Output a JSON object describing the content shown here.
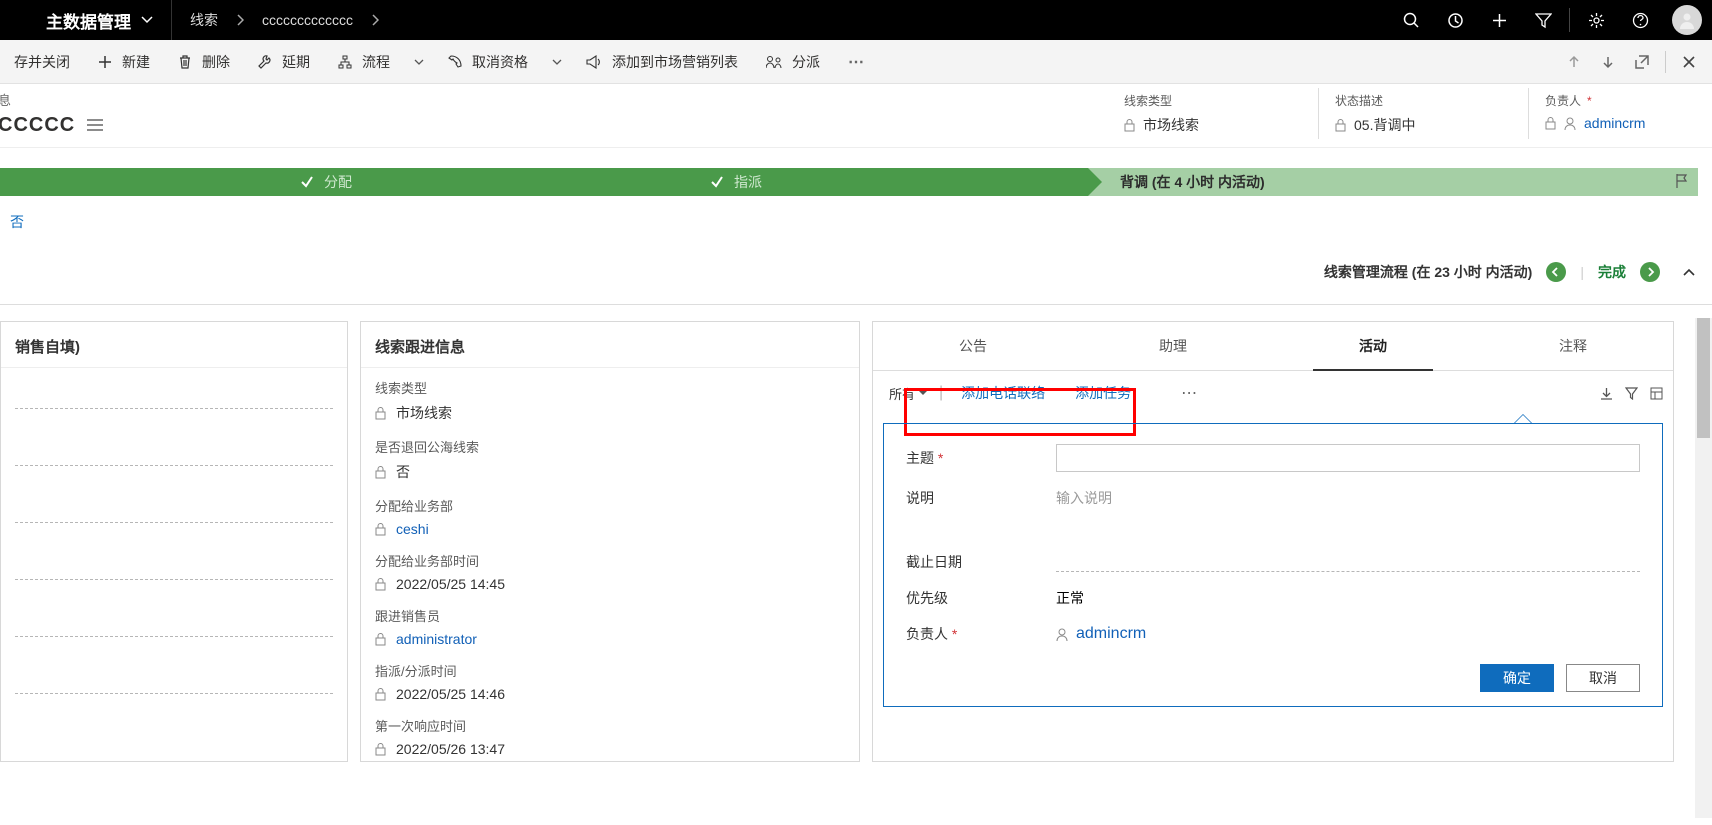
{
  "header": {
    "app_name": "主数据管理",
    "breadcrumb": [
      "线索",
      "ccccccccccccc"
    ]
  },
  "commandbar": {
    "save_close": "存并关闭",
    "new": "新建",
    "delete": "删除",
    "postpone": "延期",
    "process": "流程",
    "disqualify": "取消资格",
    "add_to_marketing": "添加到市场营销列表",
    "assign": "分派"
  },
  "record": {
    "crumb": "息",
    "title": "CCCCC"
  },
  "kpi": {
    "type_label": "线索类型",
    "type_value": "市场线索",
    "status_label": "状态描述",
    "status_value": "05.背调中",
    "owner_label": "负责人",
    "owner_value": "admincrm",
    "owner_suffix": "*"
  },
  "bpf": {
    "stage2": "分配",
    "stage3": "指派",
    "stage4": "背调 (在 4 小时 内活动)",
    "yesno": "否",
    "footer_name": "线索管理流程 (在 23 小时 内活动)",
    "done": "完成"
  },
  "left_card": {
    "title": "销售自填)"
  },
  "mid_card": {
    "title": "线索跟进信息",
    "f1_label": "线索类型",
    "f1_value": "市场线索",
    "f2_label": "是否退回公海线索",
    "f2_value": "否",
    "f3_label": "分配给业务部",
    "f3_value": "ceshi",
    "f4_label": "分配给业务部时间",
    "f4_value": "2022/05/25   14:45",
    "f5_label": "跟进销售员",
    "f5_value": "administrator",
    "f6_label": "指派/分派时间",
    "f6_value": "2022/05/25   14:46",
    "f7_label": "第一次响应时间",
    "f7_value": "2022/05/26   13:47"
  },
  "tabs": {
    "t1": "公告",
    "t2": "助理",
    "t3": "活动",
    "t4": "注释"
  },
  "activity": {
    "all": "所有",
    "add_phone": "添加电话联络",
    "add_task": "添加任务",
    "subject": "主题",
    "desc_label": "说明",
    "desc_placeholder": "输入说明",
    "due": "截止日期",
    "priority_label": "优先级",
    "priority_value": "正常",
    "owner_label": "负责人",
    "owner_value": "admincrm",
    "ok": "确定",
    "cancel": "取消"
  }
}
